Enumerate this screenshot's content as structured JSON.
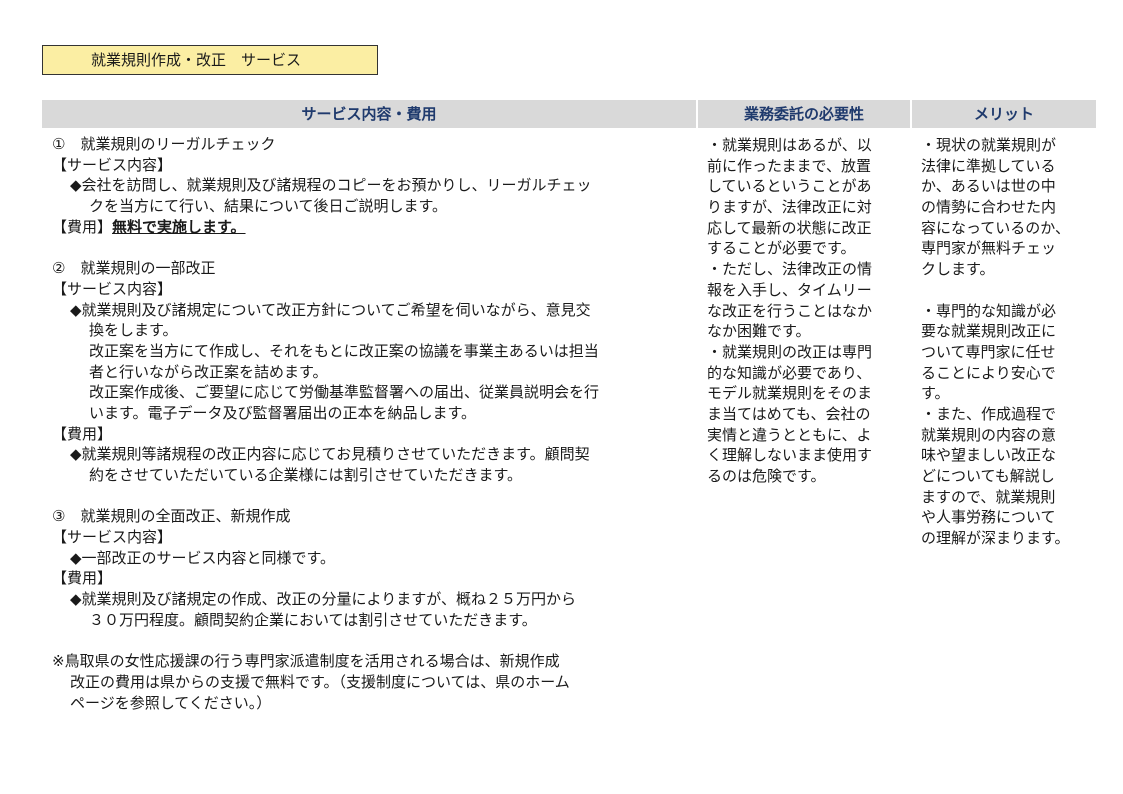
{
  "title": "就業規則作成・改正　サービス",
  "headers": [
    "サービス内容・費用",
    "業務委託の必要性",
    "メリット"
  ],
  "section1": {
    "heading": "①　就業規則のリーガルチェック",
    "content_label": "【サービス内容】",
    "content_lines": [
      "◆会社を訪問し、就業規則及び諸規程のコピーをお預かりし、リーガルチェッ",
      "クを当方にて行い、結果について後日ご説明します。"
    ],
    "fee_label": "【費用】",
    "fee_value": "無料で実施します。"
  },
  "section2": {
    "heading": "②　就業規則の一部改正",
    "content_label": "【サービス内容】",
    "content_lines": [
      "◆就業規則及び諸規定について改正方針についてご希望を伺いながら、意見交",
      "換をします。",
      "改正案を当方にて作成し、それをもとに改正案の協議を事業主あるいは担当",
      "者と行いながら改正案を詰めます。",
      "改正案作成後、ご要望に応じて労働基準監督署への届出、従業員説明会を行",
      "います。電子データ及び監督署届出の正本を納品します。"
    ],
    "fee_label": "【費用】",
    "fee_lines": [
      "◆就業規則等諸規程の改正内容に応じてお見積りさせていただきます。顧問契",
      "約をさせていただいている企業様には割引させていただきます。"
    ]
  },
  "section3": {
    "heading": "③　就業規則の全面改正、新規作成",
    "content_label": "【サービス内容】",
    "content_lines": [
      "◆一部改正のサービス内容と同様です。"
    ],
    "fee_label": "【費用】",
    "fee_lines": [
      "◆就業規則及び諸規定の作成、改正の分量によりますが、概ね２５万円から",
      "３０万円程度。顧問契約企業においては割引させていただきます。"
    ]
  },
  "note_lines": [
    "※鳥取県の女性応援課の行う専門家派遣制度を活用される場合は、新規作成",
    "改正の費用は県からの支援で無料です。（支援制度については、県のホーム",
    "ページを参照してください。）"
  ],
  "necessity_lines": [
    "・就業規則はあるが、以",
    "前に作ったままで、放置",
    "しているということがあ",
    "りますが、法律改正に対",
    "応して最新の状態に改正",
    "することが必要です。",
    "・ただし、法律改正の情",
    "報を入手し、タイムリー",
    "な改正を行うことはなか",
    "なか困難です。",
    "・就業規則の改正は専門",
    "的な知識が必要であり、",
    "モデル就業規則をそのま",
    "ま当てはめても、会社の",
    "実情と違うとともに、よ",
    "く理解しないまま使用す",
    "るのは危険です。"
  ],
  "merit_lines": [
    "・現状の就業規則が",
    "法律に準拠している",
    "か、あるいは世の中",
    "の情勢に合わせた内",
    "容になっているのか、",
    "専門家が無料チェッ",
    "クします。",
    "",
    "・専門的な知識が必",
    "要な就業規則改正に",
    "ついて専門家に任せ",
    "ることにより安心で",
    "す。",
    "・また、作成過程で",
    "就業規則の内容の意",
    "味や望ましい改正な",
    "どについても解説し",
    "ますので、就業規則",
    "や人事労務について",
    "の理解が深まります。"
  ]
}
